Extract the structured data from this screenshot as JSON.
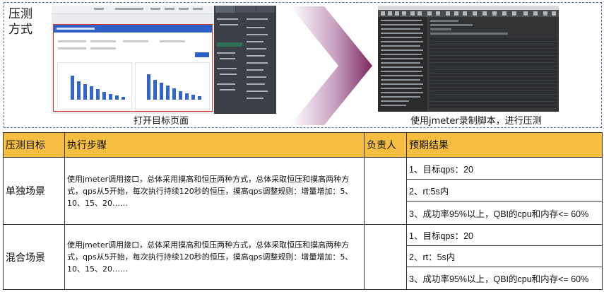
{
  "section": {
    "title": "压测\n方式"
  },
  "step1": {
    "caption": "打开目标页面"
  },
  "step2": {
    "caption": "使用jmeter录制脚本，进行压测"
  },
  "colors": {
    "header_bg": "#f6be41",
    "panel_border": "#4a6fa5",
    "arrow": "#7a2a5e",
    "highlight_red": "#d33a2c"
  },
  "table": {
    "headers": [
      "压测目标",
      "执行步骤",
      "负责人",
      "预期结果"
    ],
    "rows": [
      {
        "target": "单独场景",
        "steps": "使用jmeter调用接口，总体采用摸高和恒压两种方式，总体采取恒压和摸高两种方式，qps从5开始，每次执行持续120秒的恒压，摸高qps调整规则：增量增加：5、10、15、20……",
        "owner": "",
        "expected": [
          "1、目标qps：20",
          "2、rt:5s内",
          "3、成功率95%以上，QBI的cpu和内存<= 60%"
        ]
      },
      {
        "target": "混合场景",
        "steps": "使用jmeter调用接口，总体采用摸高和恒压两种方式，总体采取恒压和摸高两种方式，qps从5开始，每次执行持续120秒的恒压，摸高qps调整规则：增量增加：5、10、15、20……",
        "owner": "",
        "expected": [
          "1、目标qps：20",
          "2、rt：5s内",
          "3、成功率95%以上，QBI的cpu和内存<= 60%"
        ]
      }
    ]
  }
}
